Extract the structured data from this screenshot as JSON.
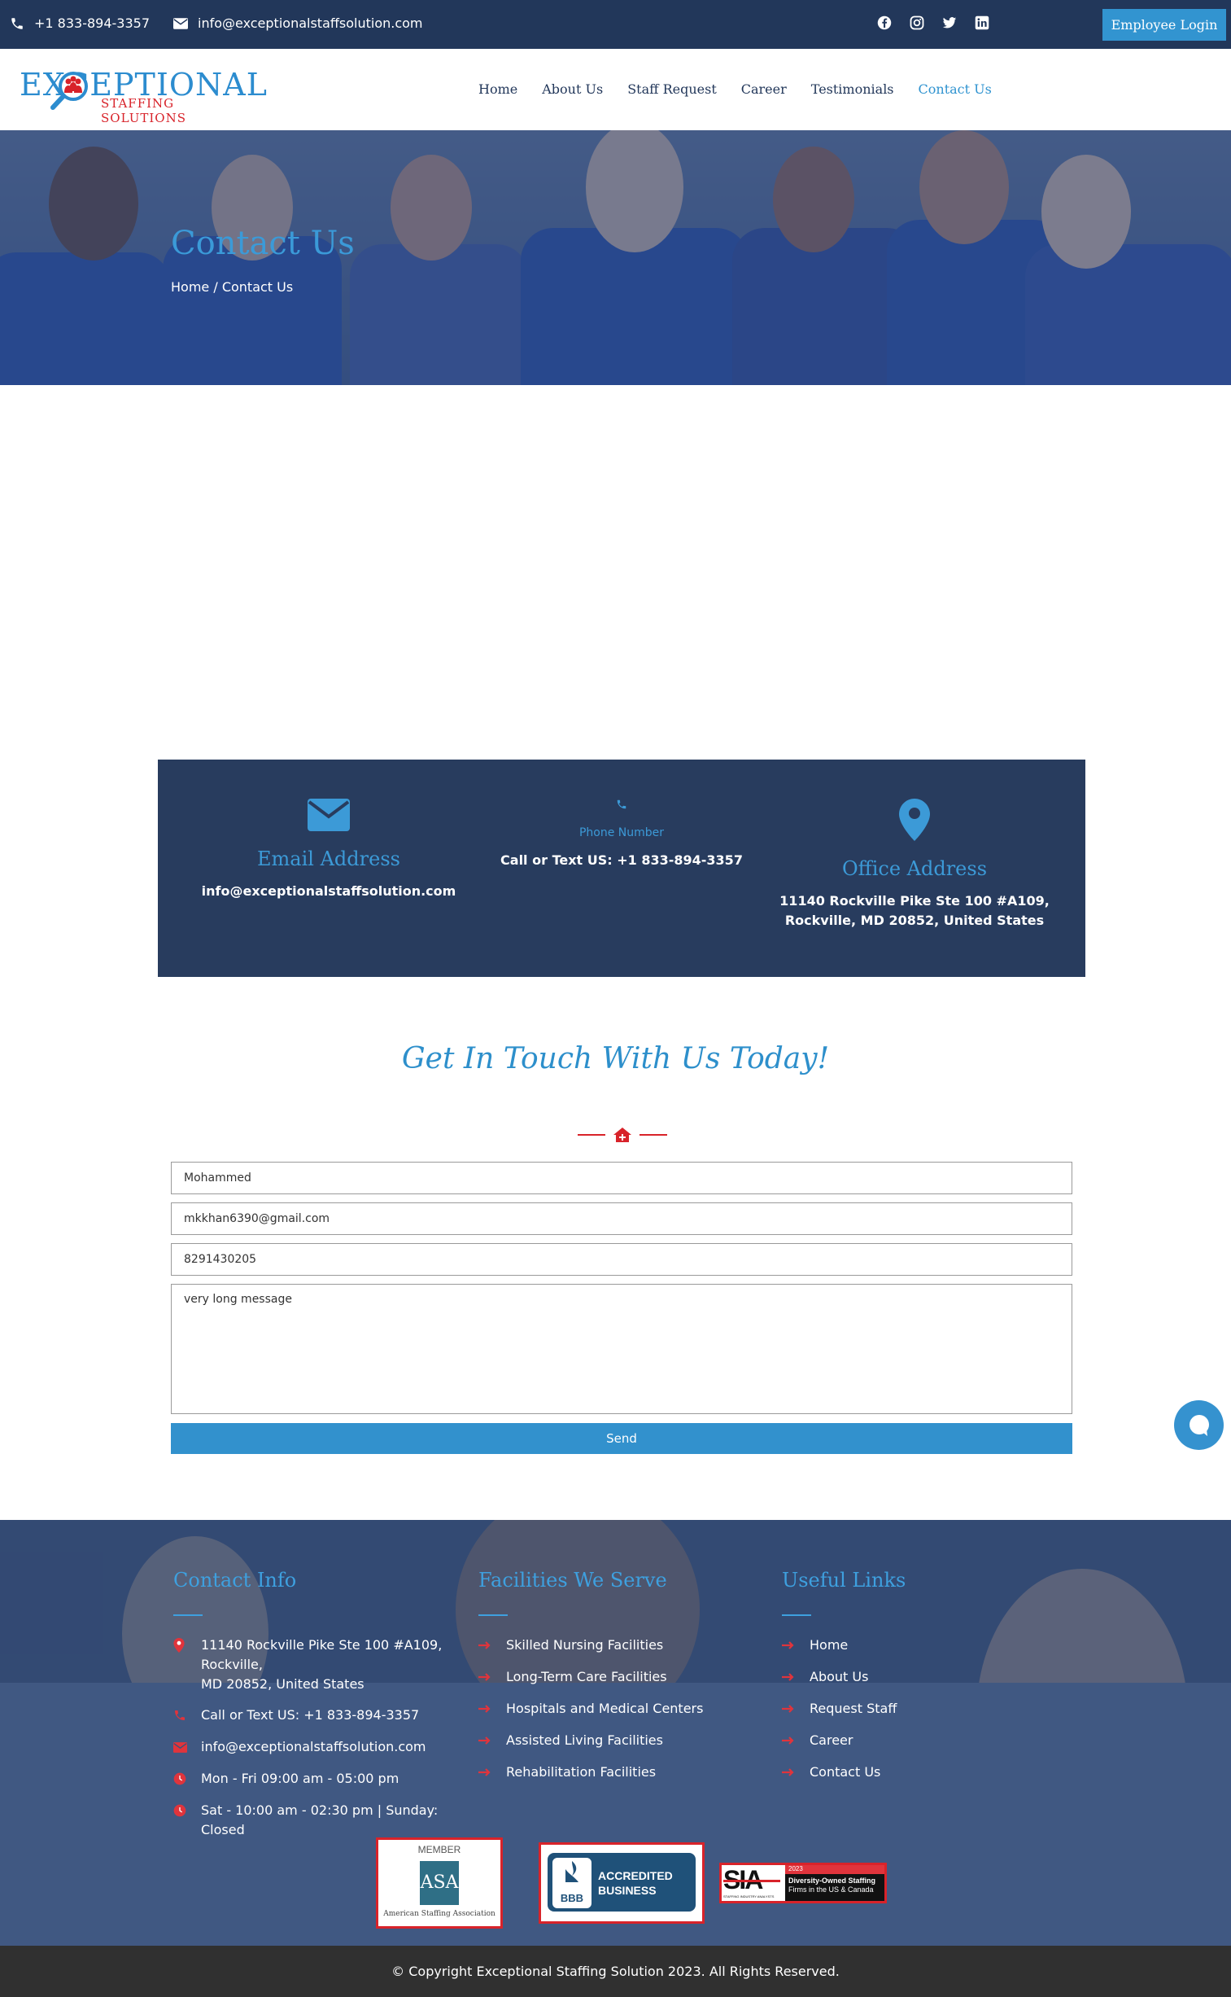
{
  "topbar": {
    "phone": "+1 833-894-3357",
    "email": "info@exceptionalstaffsolution.com",
    "social_icons": [
      "facebook-icon",
      "instagram-icon",
      "twitter-icon",
      "linkedin-icon"
    ],
    "login_label": "Employee Login"
  },
  "logo": {
    "line1": "EXCEPTIONAL",
    "line2": "STAFFING SOLUTIONS"
  },
  "nav": {
    "items": [
      "Home",
      "About Us",
      "Staff Request",
      "Career",
      "Testimonials",
      "Contact Us"
    ],
    "active": "Contact Us"
  },
  "hero": {
    "title": "Contact Us",
    "breadcrumb": "Home / Contact Us"
  },
  "info": {
    "email": {
      "title": "Email Address",
      "value": "info@exceptionalstaffsolution.com"
    },
    "phone": {
      "title": "Phone Number",
      "value": "Call or Text US: +1 833-894-3357"
    },
    "office": {
      "title": "Office Address",
      "line1": "11140 Rockville Pike Ste 100 #A109,",
      "line2": "Rockville, MD 20852, United States"
    }
  },
  "form": {
    "heading": "Get In Touch With Us Today!",
    "name": "Mohammed",
    "email": "mkkhan6390@gmail.com",
    "phone": "8291430205",
    "message": "very long message",
    "send_label": "Send"
  },
  "footer": {
    "contact": {
      "title": "Contact Info",
      "address_line1": "11140 Rockville Pike Ste 100 #A109, Rockville,",
      "address_line2": "MD 20852, United States",
      "phone": "Call or Text US: +1 833-894-3357",
      "email": "info@exceptionalstaffsolution.com",
      "hours1": "Mon - Fri 09:00 am - 05:00 pm",
      "hours2": "Sat - 10:00 am - 02:30 pm | Sunday: Closed"
    },
    "facilities": {
      "title": "Facilities We Serve",
      "items": [
        "Skilled Nursing Facilities",
        "Long-Term Care Facilities",
        "Hospitals and Medical Centers",
        "Assisted Living Facilities",
        "Rehabilitation Facilities"
      ]
    },
    "links": {
      "title": "Useful Links",
      "items": [
        "Home",
        "About Us",
        "Request Staff",
        "Career",
        "Contact Us"
      ]
    },
    "badges": {
      "asa_top": "MEMBER",
      "asa_logo": "ASA",
      "asa_bottom": "American Staffing Association",
      "bbb_logo": "BBB",
      "bbb_line1": "ACCREDITED",
      "bbb_line2": "BUSINESS",
      "sia_logo": "SIA",
      "sia_year": "2023",
      "sia_line1": "Diversity-Owned Staffing",
      "sia_line2": "Firms in the US & Canada",
      "sia_small": "STAFFING INDUSTRY ANALYSTS"
    },
    "copyright": "© Copyright Exceptional Staffing Solution 2023. All Rights Reserved."
  },
  "colors": {
    "navy": "#22375a",
    "accent": "#3294d0",
    "red": "#d8232a"
  }
}
